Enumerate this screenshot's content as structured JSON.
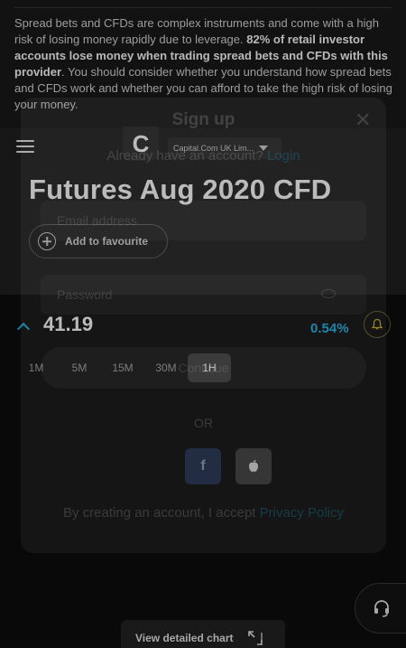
{
  "risk_banner": {
    "text_1": "Spread bets and CFDs are complex instruments and come with a high risk of losing money rapidly due to leverage.",
    "text_bold": "82% of retail investor accounts lose money when trading spread bets and CFDs with this provider",
    "text_2": ". You should consider whether you understand how spread bets and CFDs work and whether you can afford to take the high risk of losing your money."
  },
  "header": {
    "logo_letter": "C",
    "entity": "Capital.Com UK Lim..."
  },
  "instrument": {
    "title": "Futures Aug 2020 CFD",
    "favourite_label": "Add to favourite",
    "price": "41.19",
    "change": "0.54%"
  },
  "timeframes": [
    "1M",
    "5M",
    "15M",
    "30M",
    "1H"
  ],
  "timeframe_active": "1H",
  "chart_button": {
    "label": "View detailed chart"
  },
  "modal": {
    "title": "Sign up",
    "have_account": "Already have an account?",
    "login_link": "Login",
    "email_placeholder": "Email address",
    "password_placeholder": "Password",
    "continue_label": "Continue",
    "or_text": "OR",
    "terms_text": "By creating an account, I accept",
    "privacy_link": "Privacy Policy"
  },
  "colors": {
    "accent": "#1db0e6",
    "alert": "#c9a92b",
    "background": "#0d0d0d"
  },
  "icons": [
    "menu-icon",
    "chevron-down-icon",
    "plus-circle-icon",
    "chevron-up-icon",
    "bell-icon",
    "headset-icon",
    "expand-icon",
    "close-icon",
    "eye-icon",
    "facebook-icon",
    "apple-icon"
  ]
}
